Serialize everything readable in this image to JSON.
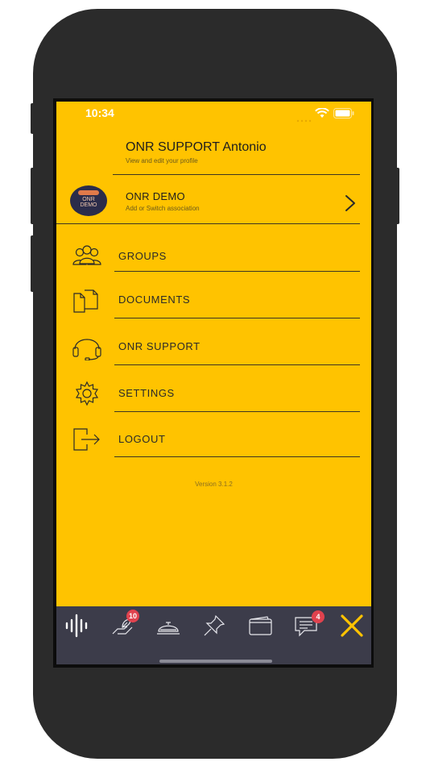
{
  "status_bar": {
    "time": "10:34"
  },
  "profile": {
    "name": "ONR SUPPORT Antonio",
    "subtitle": "View and edit your profile"
  },
  "association": {
    "name": "ONR DEMO",
    "subtitle": "Add or Switch association",
    "avatar_text": [
      "ONR",
      "DEMO"
    ]
  },
  "menu": [
    {
      "label": "GROUPS",
      "icon": "groups-icon"
    },
    {
      "label": "DOCUMENTS",
      "icon": "documents-icon"
    },
    {
      "label": "ONR SUPPORT",
      "icon": "headset-icon"
    },
    {
      "label": "SETTINGS",
      "icon": "gear-icon"
    },
    {
      "label": "LOGOUT",
      "icon": "logout-icon"
    }
  ],
  "version": "Version 3.1.2",
  "tabbar": {
    "items": [
      {
        "icon": "audio-wave-icon"
      },
      {
        "icon": "hand-plant-icon",
        "badge": "10"
      },
      {
        "icon": "service-bell-icon"
      },
      {
        "icon": "pushpin-icon"
      },
      {
        "icon": "wallet-icon"
      },
      {
        "icon": "chat-icon",
        "badge": "4"
      },
      {
        "icon": "close-icon"
      }
    ]
  },
  "colors": {
    "background": "#ffc300",
    "tabbar": "#3c3c4a",
    "badge": "#e0424e",
    "accent": "#ffc300"
  }
}
